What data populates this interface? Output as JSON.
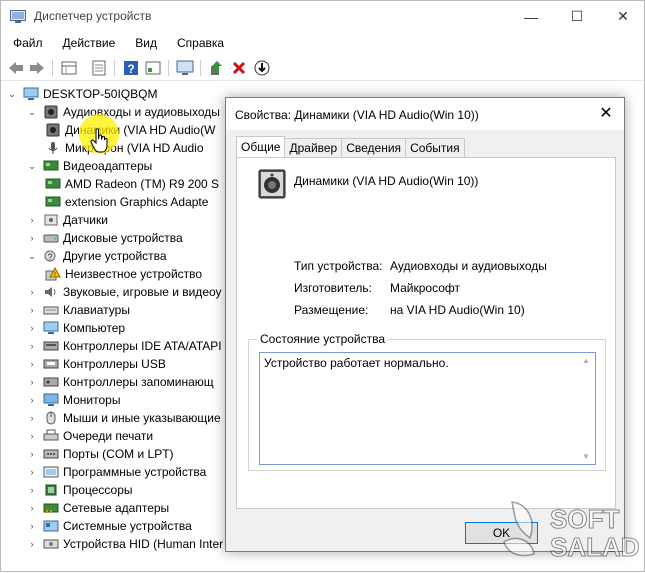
{
  "window": {
    "title": "Диспетчер устройств",
    "controls": {
      "minimize": "—",
      "maximize": "☐",
      "close": "✕"
    }
  },
  "menu": [
    "Файл",
    "Действие",
    "Вид",
    "Справка"
  ],
  "toolbar": {
    "icons": [
      "back-icon",
      "forward-icon",
      "properties-grid-icon",
      "show-hidden-icon",
      "help-icon",
      "details-icon",
      "monitor-icon",
      "update-driver-icon",
      "uninstall-icon",
      "scan-hardware-icon"
    ]
  },
  "tree": {
    "root": "DESKTOP-50IQBQM",
    "items": [
      {
        "label": "Аудиовходы и аудиовыходы",
        "expanded": true,
        "icon": "speaker-icon"
      },
      {
        "label": "Динамики (VIA HD Audio(W",
        "child": true,
        "icon": "speaker-icon"
      },
      {
        "label": "Микрофон (VIA HD Audio",
        "child": true,
        "icon": "microphone-icon"
      },
      {
        "label": "Видеоадаптеры",
        "expanded": true,
        "icon": "display-adapter-icon"
      },
      {
        "label": "AMD Radeon (TM) R9 200 S",
        "child": true,
        "icon": "display-adapter-icon"
      },
      {
        "label": "extension Graphics Adapte",
        "child": true,
        "icon": "display-adapter-icon"
      },
      {
        "label": "Датчики",
        "icon": "sensor-icon"
      },
      {
        "label": "Дисковые устройства",
        "icon": "disk-icon"
      },
      {
        "label": "Другие устройства",
        "expanded": true,
        "icon": "unknown-device-icon"
      },
      {
        "label": "Неизвестное устройство",
        "child": true,
        "icon": "warning-device-icon"
      },
      {
        "label": "Звуковые, игровые и видеоу",
        "icon": "sound-icon"
      },
      {
        "label": "Клавиатуры",
        "icon": "keyboard-icon"
      },
      {
        "label": "Компьютер",
        "icon": "computer-icon"
      },
      {
        "label": "Контроллеры IDE ATA/ATAPI",
        "icon": "ide-controller-icon"
      },
      {
        "label": "Контроллеры USB",
        "icon": "usb-icon"
      },
      {
        "label": "Контроллеры запоминающ",
        "icon": "storage-controller-icon"
      },
      {
        "label": "Мониторы",
        "icon": "monitor-icon"
      },
      {
        "label": "Мыши и иные указывающие",
        "icon": "mouse-icon"
      },
      {
        "label": "Очереди печати",
        "icon": "printer-icon"
      },
      {
        "label": "Порты (COM и LPT)",
        "icon": "port-icon"
      },
      {
        "label": "Программные устройства",
        "icon": "software-device-icon"
      },
      {
        "label": "Процессоры",
        "icon": "processor-icon"
      },
      {
        "label": "Сетевые адаптеры",
        "icon": "network-adapter-icon"
      },
      {
        "label": "Системные устройства",
        "icon": "system-device-icon"
      },
      {
        "label": "Устройства HID (Human Inter",
        "icon": "hid-icon"
      }
    ]
  },
  "dialog": {
    "title": "Свойства: Динамики (VIA HD Audio(Win 10))",
    "close": "✕",
    "tabs": [
      "Общие",
      "Драйвер",
      "Сведения",
      "События"
    ],
    "device_name": "Динамики (VIA HD Audio(Win 10))",
    "properties": [
      {
        "label": "Тип устройства:",
        "value": "Аудиовходы и аудиовыходы"
      },
      {
        "label": "Изготовитель:",
        "value": "Майкрософт"
      },
      {
        "label": "Размещение:",
        "value": "на VIA HD Audio(Win 10)"
      }
    ],
    "status_group_title": "Состояние устройства",
    "status_text": "Устройство работает нормально.",
    "ok_label": "OK"
  },
  "watermark": {
    "line1": "SOFT",
    "line2": "SALAD"
  }
}
